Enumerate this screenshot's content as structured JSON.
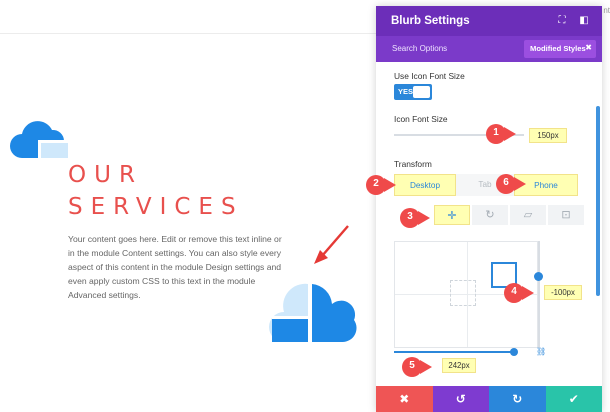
{
  "page": {
    "corner_text": "nt",
    "heading_line1": "OUR",
    "heading_line2": "SERVICES",
    "body": "Your content goes here. Edit or remove this text inline or in the module Content settings. You can also style every aspect of this content in the module Design settings and even apply custom CSS to this text in the module Advanced settings."
  },
  "panel": {
    "title": "Blurb Settings",
    "search_options": "Search Options",
    "modified_styles": "Modified Styles",
    "use_icon_font_size_label": "Use Icon Font Size",
    "toggle_value": "YES",
    "icon_font_size_label": "Icon Font Size",
    "icon_font_size_value": "150px",
    "transform_label": "Transform",
    "tabs": [
      "Desktop",
      "Tab",
      "Phone"
    ],
    "translate_y_value": "-100px",
    "translate_x_value": "242px"
  },
  "badges": [
    "1",
    "2",
    "3",
    "4",
    "5",
    "6"
  ],
  "colors": {
    "purple_header": "#6c2eb9",
    "accent_blue": "#2b87da",
    "heading_red": "#e8504d",
    "badge_red": "#ef4a4a",
    "highlight_yellow": "#ffffb3"
  }
}
